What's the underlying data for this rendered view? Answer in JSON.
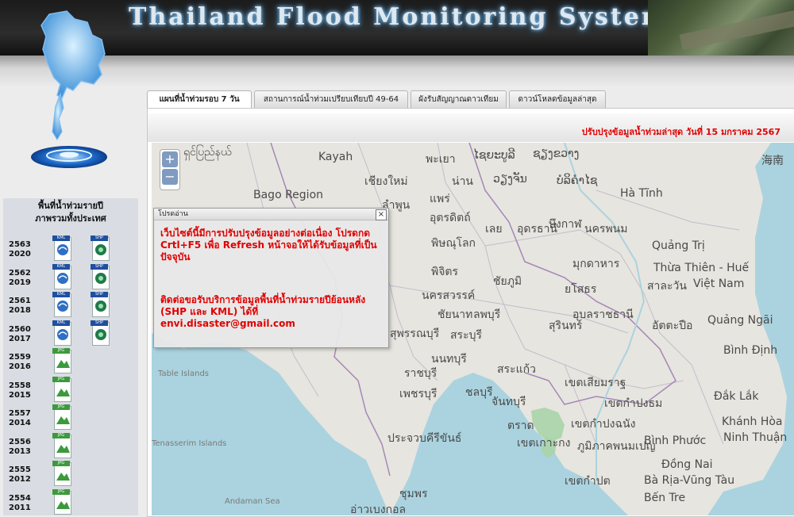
{
  "header": {
    "title": "Thailand Flood Monitoring System"
  },
  "left_panel": {
    "title_line1": "พื้นที่น้ำท่วมรายปี",
    "title_line2": "ภาพรวมทั้งประเทศ",
    "years": [
      {
        "be": "2563",
        "ce": "2020",
        "files": [
          "KML",
          "SHP"
        ]
      },
      {
        "be": "2562",
        "ce": "2019",
        "files": [
          "KML",
          "SHP"
        ]
      },
      {
        "be": "2561",
        "ce": "2018",
        "files": [
          "KML",
          "SHP"
        ]
      },
      {
        "be": "2560",
        "ce": "2017",
        "files": [
          "KML",
          "SHP"
        ]
      },
      {
        "be": "2559",
        "ce": "2016",
        "files": [
          "JPG"
        ]
      },
      {
        "be": "2558",
        "ce": "2015",
        "files": [
          "JPG"
        ]
      },
      {
        "be": "2557",
        "ce": "2014",
        "files": [
          "JPG"
        ]
      },
      {
        "be": "2556",
        "ce": "2013",
        "files": [
          "JPG"
        ]
      },
      {
        "be": "2555",
        "ce": "2012",
        "files": [
          "JPG"
        ]
      },
      {
        "be": "2554",
        "ce": "2011",
        "files": [
          "JPG"
        ]
      }
    ]
  },
  "tabs": [
    {
      "label": "แผนที่น้ำท่วมรอบ 7 วัน",
      "active": true
    },
    {
      "label": "สถานการณ์น้ำท่วมเปรียบเทียบปี 49-64",
      "active": false
    },
    {
      "label": "ผังรับสัญญาณดาวเทียม",
      "active": false
    },
    {
      "label": "ดาวน์โหลดข้อมูลล่าสุด",
      "active": false
    }
  ],
  "update_text": "ปรับปรุงข้อมูลน้ำท่วมล่าสุด วันที่ 15 มกราคม 2567",
  "map": {
    "zoom_in": "+",
    "zoom_out": "−",
    "labels": [
      "ရှင်ပြည်နယ်",
      "Kayah",
      "พะเยา",
      "ໄຊຍະບູລີ",
      "ຊຽງຂວາງ",
      "海南",
      "เชียงใหม่",
      "น่าน",
      "ວຽງຈັນ",
      "ບໍລິຄໍາໄຊ",
      "Bago Region",
      "ลำพูน",
      "แพร่",
      "Hà Tĩnh",
      "อุตรดิตถ์",
      "บึงกาฬ",
      "เลย",
      "อุดรธานี",
      "นครพนม",
      "พิษณุโลก",
      "Quảng Trị",
      "มุกดาหาร",
      "Thừa Thiên - Huế",
      "พิจิตร",
      "ชัยภูมิ",
      "สาละวัน",
      "Việt Nam",
      "นครสวรรค์",
      "ยโสธร",
      "ชัยนาท",
      "ลพบุรี",
      "อุบลราชธานี",
      "สุรินทร์",
      "อัตตะปือ",
      "Quảng Ngãi",
      "สุพรรณบุรี",
      "สระบุรี",
      "Bình Định",
      "นนทบุรี",
      "สระแก้ว",
      "ราชบุรี",
      "เขตเสียมราฐ",
      "เพชรบุรี",
      "ชลบุรี",
      "จันทบุรี",
      "เขตกำปงธม",
      "Đắk Lắk",
      "ตราด",
      "เขตกำปงฉนัง",
      "Khánh Hòa",
      "ประจวบคีรีขันธ์",
      "เขตเกาะกง",
      "ภูมิภาคพนมเปญ",
      "Bình Phước",
      "Ninh Thuận",
      "Đồng Nai",
      "เขตกำปต",
      "Bà Rịa-Vũng Tàu",
      "ชุมพร",
      "Bến Tre",
      "อ่าวเบงกอล",
      "Andaman Sea",
      "Table Islands",
      "Tenasserim Islands"
    ]
  },
  "popup": {
    "title": "โปรดอ่าน",
    "close": "×",
    "message1": "เว็บไซต์นี้มีการปรับปรุงข้อมูลอย่างต่อเนื่อง โปรดกด Crtl+F5 เพื่อ Refresh หน้าจอให้ได้รับข้อมูลที่เป็นปัจจุบัน",
    "message2": "ติดต่อขอรับบริการข้อมูลพื้นที่น้ำท่วมรายปีย้อนหลัง (SHP และ KML) ได้ที่ envi.disaster@gmail.com"
  },
  "colors": {
    "alert_red": "#e00000",
    "sea": "#aad3df",
    "flood": "#a8d4a8"
  }
}
